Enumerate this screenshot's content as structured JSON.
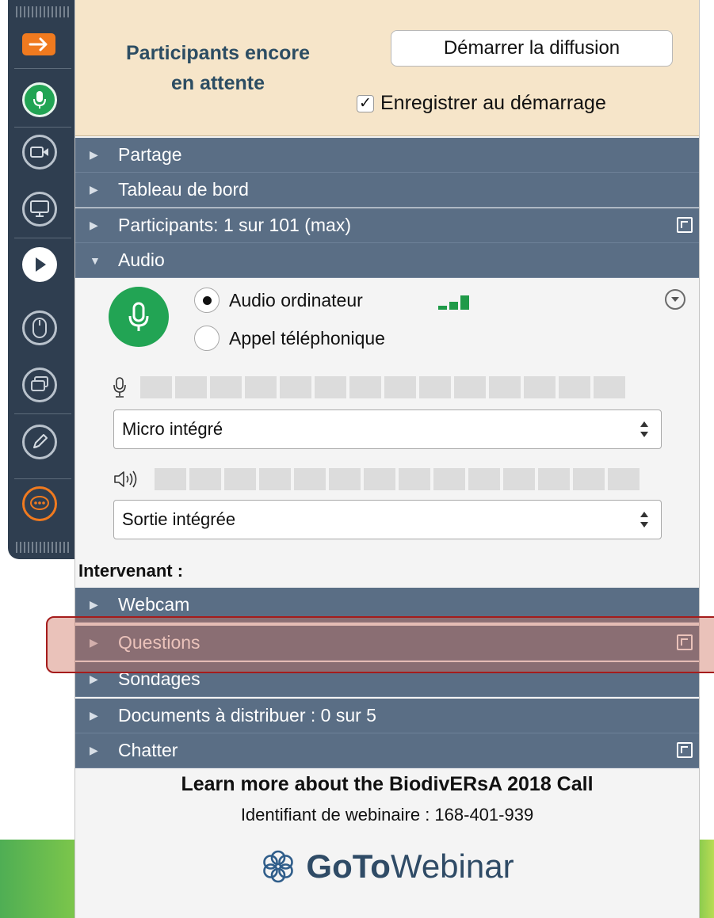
{
  "header": {
    "waiting_line1": "Participants encore",
    "waiting_line2": "en attente",
    "start_button": "Démarrer la diffusion",
    "record_checked": true,
    "record_label": "Enregistrer au démarrage"
  },
  "toolbar": {
    "icons": [
      "arrow-right-icon",
      "microphone-icon",
      "webcam-icon",
      "screen-share-icon",
      "play-icon",
      "mouse-icon",
      "screens-icon",
      "pen-icon",
      "chat-icon"
    ]
  },
  "sections": {
    "partage": "Partage",
    "tableau": "Tableau de bord",
    "participants": "Participants: 1 sur 101 (max)",
    "audio": "Audio",
    "webcam": "Webcam",
    "questions": "Questions",
    "sondages": "Sondages",
    "documents": "Documents à distribuer : 0 sur 5",
    "chatter": "Chatter"
  },
  "audio": {
    "option_computer": "Audio ordinateur",
    "option_phone": "Appel téléphonique",
    "selected": "Audio ordinateur",
    "signal_bars": 3,
    "mic_device": "Micro intégré",
    "speaker_device": "Sortie intégrée",
    "mic_level": 0,
    "speaker_level": 0
  },
  "presenter_label": "Intervenant :",
  "footer": {
    "title": "Learn more about the BiodivERsA 2018 Call",
    "webinar_id": "Identifiant de webinaire : 168-401-939",
    "brand_goto": "GoTo",
    "brand_webinar": "Webinar"
  },
  "colors": {
    "section_bar": "#5a6e85",
    "header_bg": "#f6e5c9",
    "green": "#22a454",
    "orange": "#f07a1f",
    "toolbar_bg": "#2f3e50",
    "highlight": "#a51c1c"
  }
}
